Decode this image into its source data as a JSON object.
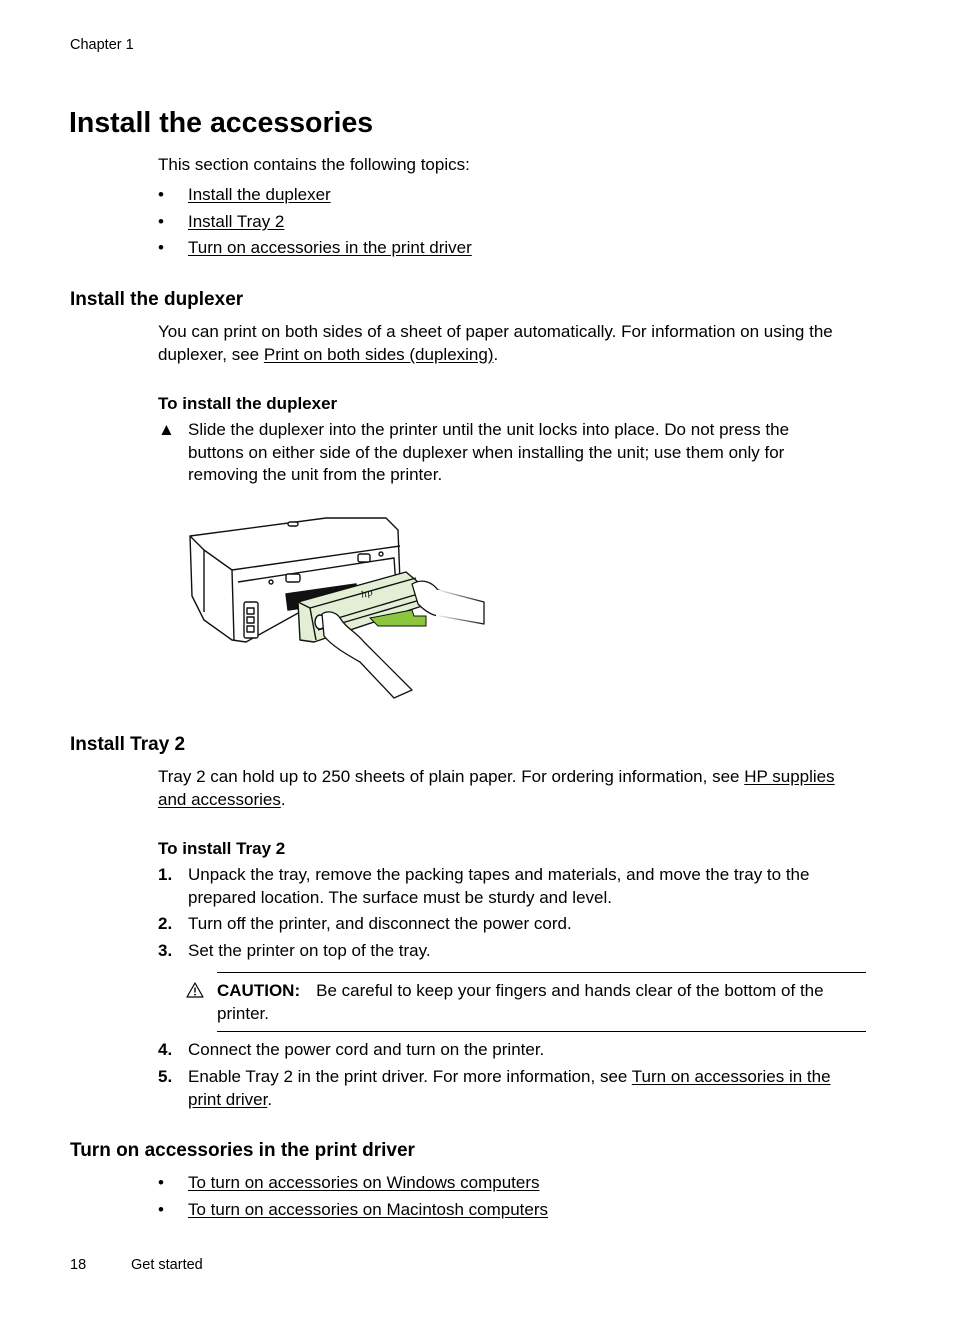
{
  "header": {
    "running_head": "Chapter 1"
  },
  "title": "Install the accessories",
  "intro": {
    "text": "This section contains the following topics:",
    "topics": [
      {
        "label": "Install the duplexer"
      },
      {
        "label": "Install Tray 2"
      },
      {
        "label": "Turn on accessories in the print driver"
      }
    ]
  },
  "duplexer": {
    "heading": "Install the duplexer",
    "para_prefix": "You can print on both sides of a sheet of paper automatically. For information on using the duplexer, see ",
    "para_link": "Print on both sides (duplexing)",
    "para_suffix": ".",
    "procedure_title": "To install the duplexer",
    "step_icon": "▲",
    "step_text": "Slide the duplexer into the printer until the unit locks into place. Do not press the buttons on either side of the duplexer when installing the unit; use them only for removing the unit from the printer.",
    "illustration": {
      "description": "Hands sliding the duplexer unit into the back of the printer",
      "logo_text": "hp",
      "colors": {
        "duplexer": "#e2efd4",
        "arrow": "#8cc63f",
        "outline": "#111111"
      }
    }
  },
  "tray2": {
    "heading": "Install Tray 2",
    "para_prefix": "Tray 2 can hold up to 250 sheets of plain paper. For ordering information, see ",
    "para_link": "HP supplies and accessories",
    "para_suffix": ".",
    "procedure_title": "To install Tray 2",
    "steps": [
      {
        "num": "1.",
        "text": "Unpack the tray, remove the packing tapes and materials, and move the tray to the prepared location. The surface must be sturdy and level."
      },
      {
        "num": "2.",
        "text": "Turn off the printer, and disconnect the power cord."
      },
      {
        "num": "3.",
        "text": "Set the printer on top of the tray."
      },
      {
        "num": "4.",
        "text": "Connect the power cord and turn on the printer."
      },
      {
        "num": "5.",
        "text_prefix": "Enable Tray 2 in the print driver. For more information, see ",
        "link": "Turn on accessories in the print driver",
        "text_suffix": "."
      }
    ],
    "caution": {
      "label": "CAUTION:",
      "text": "Be careful to keep your fingers and hands clear of the bottom of the printer."
    }
  },
  "driver": {
    "heading": "Turn on accessories in the print driver",
    "links": [
      {
        "label": "To turn on accessories on Windows computers"
      },
      {
        "label": "To turn on accessories on Macintosh computers"
      }
    ]
  },
  "footer": {
    "page_number": "18",
    "section": "Get started"
  },
  "bullet_glyph": "•"
}
